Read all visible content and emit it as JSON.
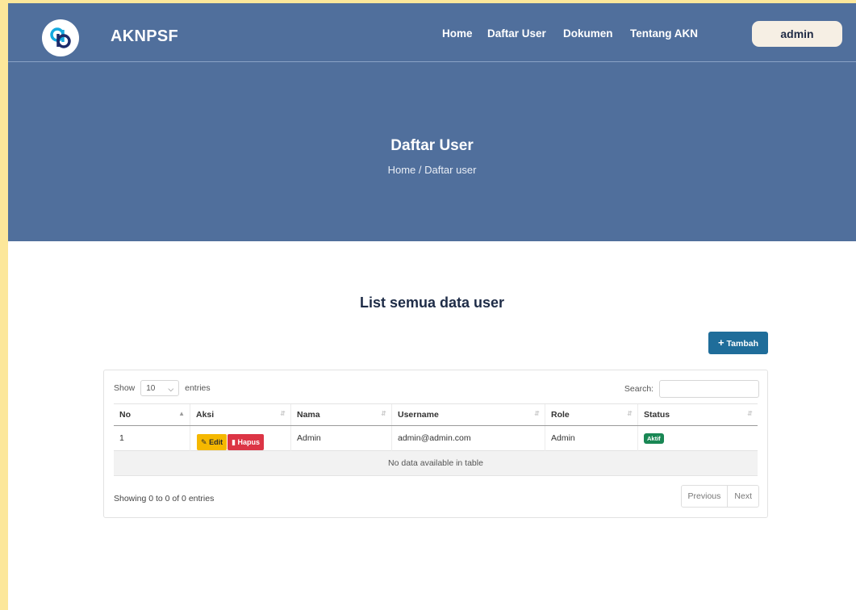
{
  "navbar": {
    "brand": "AKNPSF",
    "links": [
      "Home",
      "Daftar User",
      "Dokumen",
      "Tentang AKN"
    ],
    "user_button": "admin",
    "logo_icon": "ab-monogram-icon"
  },
  "hero": {
    "title": "Daftar User",
    "breadcrumb": "Home / Daftar user"
  },
  "section": {
    "title": "List semua data user",
    "add_button": "Tambah",
    "add_icon": "plus-icon"
  },
  "datatable": {
    "show_label": "Show",
    "page_length": "10",
    "entries_label": "entries",
    "search_label": "Search:",
    "search_value": "",
    "columns": [
      "No",
      "Aksi",
      "Nama",
      "Username",
      "Role",
      "Status"
    ],
    "rows": [
      {
        "no": "1",
        "edit_label": "Edit",
        "delete_label": "Hapus",
        "nama": "Admin",
        "username": "admin@admin.com",
        "role": "Admin",
        "status": "Aktif"
      }
    ],
    "empty_message": "No data available in table",
    "info": "Showing 0 to 0 of 0 entries",
    "prev_label": "Previous",
    "next_label": "Next"
  },
  "colors": {
    "header_bg": "#506f9c",
    "outer_bg": "#fce79a",
    "add_button": "#1f6d9a",
    "edit_button": "#f5b800",
    "delete_button": "#dc3545",
    "status_badge": "#198754"
  }
}
